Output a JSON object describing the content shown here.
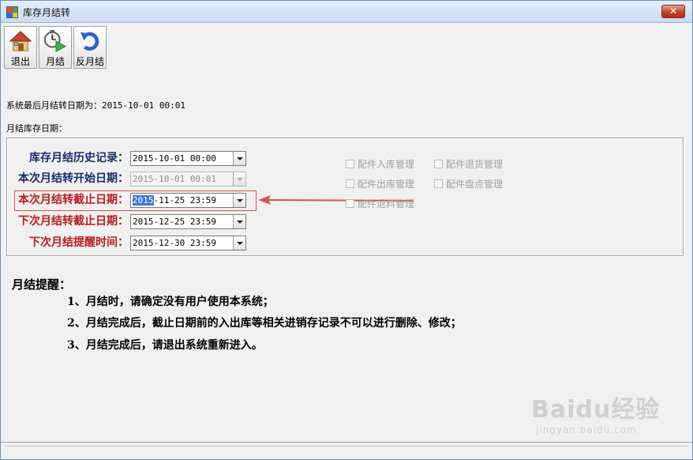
{
  "window": {
    "title": "库存月结转"
  },
  "toolbar": {
    "exit_label": "退出",
    "close_month_label": "月结",
    "reverse_close_label": "反月结"
  },
  "last_close": {
    "label": "系统最后月结转日期为：",
    "value": "2015-10-01 00:01"
  },
  "group": {
    "caption": "月结库存日期："
  },
  "fields": {
    "history": {
      "label": "库存月结历史记录：",
      "value": "2015-10-01 00:00"
    },
    "start": {
      "label": "本次月结转开始日期：",
      "value": "2015-10-01 00:01"
    },
    "end": {
      "label": "本次月结转截止日期：",
      "value_selected": "2015",
      "value_rest": "-11-25 23:59"
    },
    "next_end": {
      "label": "下次月结转截止日期：",
      "value": "2015-12-25 23:59"
    },
    "reminder_time": {
      "label": "下次月结提醒时间：",
      "value": "2015-12-30 23:59"
    }
  },
  "checkboxes": {
    "inbound": "配件入库管理",
    "return_goods": "配件退货管理",
    "outbound": "配件出库管理",
    "inventory": "配件盘点管理",
    "return_material": "配件退料管理"
  },
  "reminders": {
    "title": "月结提醒：",
    "item1": "1、月结时，请确定没有用户使用本系统；",
    "item2": "2、月结完成后，截止日期前的入出库等相关进销存记录不可以进行删除、修改；",
    "item3": "3、月结完成后，请退出系统重新进入。"
  },
  "watermark": {
    "main": "Baidu经验",
    "sub": "jingyan.baidu.com"
  },
  "colors": {
    "label_navy": "#1a2a6c",
    "label_red": "#b81c1c",
    "highlight": "#d9534f"
  }
}
